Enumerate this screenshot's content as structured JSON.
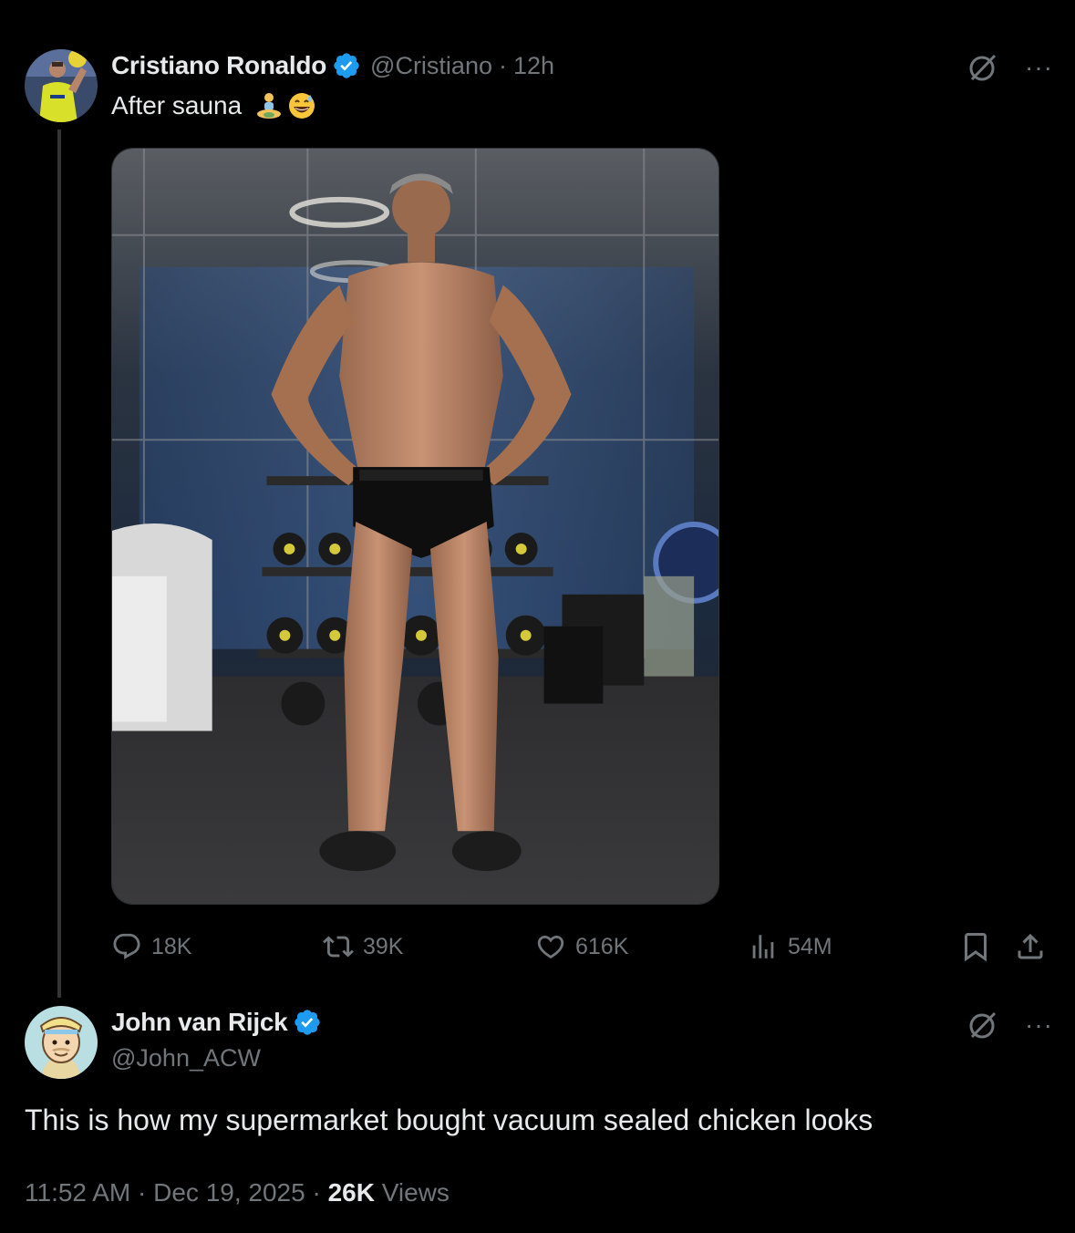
{
  "tweet": {
    "display_name": "Cristiano Ronaldo",
    "handle": "@Cristiano",
    "separator": "·",
    "time": "12h",
    "text": "After sauna",
    "emojis": [
      "person-in-lotus-position",
      "grinning-face-with-sweat"
    ],
    "media_description_icon": "gym-photo",
    "actions": {
      "replies": "18K",
      "reposts": "39K",
      "likes": "616K",
      "views": "54M"
    }
  },
  "reply": {
    "display_name": "John van Rijck",
    "handle": "@John_ACW",
    "text": "This is how my supermarket bought vacuum sealed chicken looks",
    "time": "11:52 AM",
    "separator1": "·",
    "date": "Dec 19, 2025",
    "separator2": "·",
    "views_count": "26K",
    "views_label": "Views"
  },
  "icons": {
    "verified": "verified-badge-icon",
    "grok": "grok-icon",
    "more": "more-icon",
    "reply": "reply-icon",
    "repost": "repost-icon",
    "like": "like-icon",
    "views": "views-icon",
    "bookmark": "bookmark-icon",
    "share": "share-icon"
  },
  "colors": {
    "background": "#000000",
    "primary_text": "#e7e9ea",
    "secondary_text": "#71767b",
    "verified_blue": "#1d9bf0",
    "thread_line": "#333639"
  }
}
